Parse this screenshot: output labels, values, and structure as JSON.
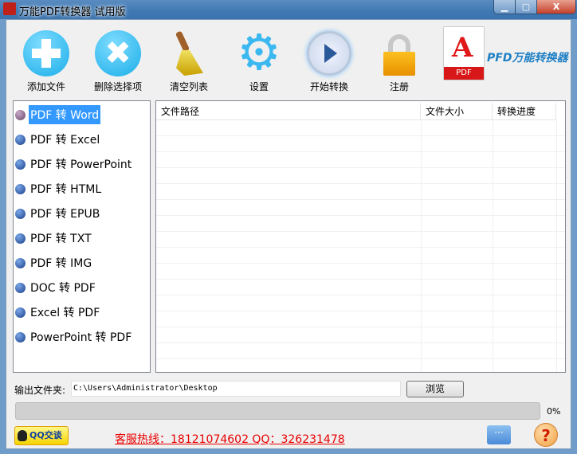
{
  "window": {
    "title": "万能PDF转换器 试用版",
    "min": "▁",
    "max": "▢",
    "close": "X"
  },
  "toolbar": [
    {
      "id": "add",
      "label": "添加文件",
      "icon": "plus-icon"
    },
    {
      "id": "delete",
      "label": "删除选择项",
      "icon": "x-icon"
    },
    {
      "id": "clear",
      "label": "清空列表",
      "icon": "broom-icon"
    },
    {
      "id": "settings",
      "label": "设置",
      "icon": "gear-icon"
    },
    {
      "id": "start",
      "label": "开始转换",
      "icon": "play-icon"
    },
    {
      "id": "register",
      "label": "注册",
      "icon": "lock-icon"
    }
  ],
  "logo": {
    "text": "PFD万能转换器",
    "doc_label": "PDF"
  },
  "modes": [
    "PDF 转 Word",
    "PDF 转 Excel",
    "PDF 转 PowerPoint",
    "PDF 转 HTML",
    "PDF 转 EPUB",
    "PDF 转 TXT",
    "PDF 转 IMG",
    "DOC 转 PDF",
    "Excel 转 PDF",
    "PowerPoint 转 PDF"
  ],
  "table": {
    "columns": [
      "文件路径",
      "文件大小",
      "转换进度"
    ],
    "rows": []
  },
  "output": {
    "label": "输出文件夹:",
    "path": "C:\\Users\\Administrator\\Desktop",
    "browse": "浏览"
  },
  "progress": {
    "value": 0,
    "label": "0%"
  },
  "footer": {
    "qq": "QQ交谈",
    "hotline": "客服热线：18121074602 QQ：326231478",
    "chat": "···",
    "help": "?"
  }
}
